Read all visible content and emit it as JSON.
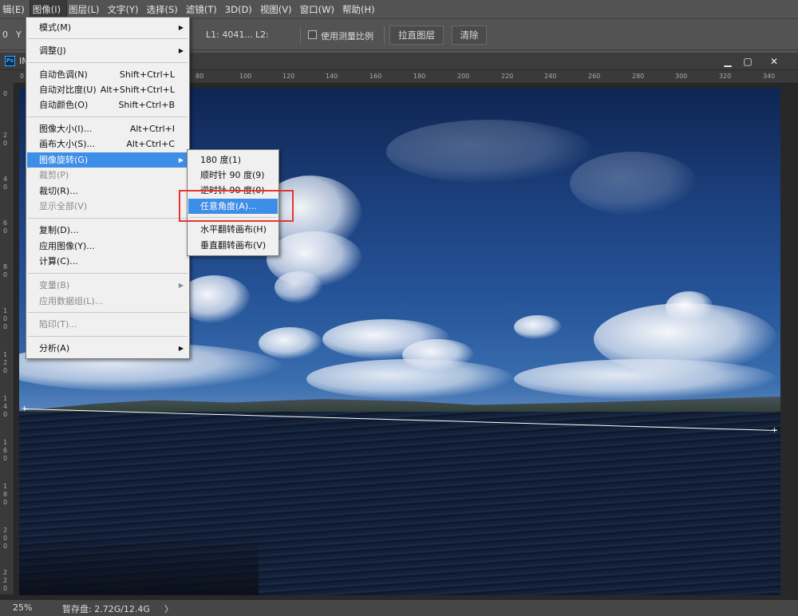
{
  "menubar": {
    "items": [
      "辑(E)",
      "图像(I)",
      "图层(L)",
      "文字(Y)",
      "选择(S)",
      "滤镜(T)",
      "3D(D)",
      "视图(V)",
      "窗口(W)",
      "帮助(H)"
    ]
  },
  "options": {
    "x_label": "0",
    "y_label": "Y",
    "l1": "L1: 4041...",
    "l2": "L2:",
    "measure_scale": "使用测量比例",
    "straighten_button": "拉直图层",
    "clear_button": "清除"
  },
  "document": {
    "title": "IM",
    "ruler_h": [
      "0",
      "80",
      "100",
      "120",
      "140",
      "160",
      "180",
      "200",
      "220",
      "240",
      "260",
      "280",
      "300",
      "320",
      "340"
    ],
    "ruler_v": [
      "0",
      "20",
      "40",
      "60",
      "80",
      "100",
      "120",
      "140",
      "160",
      "180",
      "200",
      "220"
    ]
  },
  "image_menu": {
    "items": [
      {
        "label": "模式(M)",
        "submenu": true
      },
      {
        "divider": true
      },
      {
        "label": "调整(J)",
        "submenu": true
      },
      {
        "divider": true
      },
      {
        "label": "自动色调(N)",
        "shortcut": "Shift+Ctrl+L"
      },
      {
        "label": "自动对比度(U)",
        "shortcut": "Alt+Shift+Ctrl+L"
      },
      {
        "label": "自动颜色(O)",
        "shortcut": "Shift+Ctrl+B"
      },
      {
        "divider": true
      },
      {
        "label": "图像大小(I)...",
        "shortcut": "Alt+Ctrl+I"
      },
      {
        "label": "画布大小(S)...",
        "shortcut": "Alt+Ctrl+C"
      },
      {
        "label": "图像旋转(G)",
        "submenu": true,
        "highlight": true
      },
      {
        "label": "裁剪(P)",
        "disabled": true
      },
      {
        "label": "裁切(R)..."
      },
      {
        "label": "显示全部(V)",
        "disabled": true
      },
      {
        "divider": true
      },
      {
        "label": "复制(D)..."
      },
      {
        "label": "应用图像(Y)..."
      },
      {
        "label": "计算(C)..."
      },
      {
        "divider": true
      },
      {
        "label": "变量(B)",
        "submenu": true,
        "disabled": true
      },
      {
        "label": "应用数据组(L)...",
        "disabled": true
      },
      {
        "divider": true
      },
      {
        "label": "陷印(T)...",
        "disabled": true
      },
      {
        "divider": true
      },
      {
        "label": "分析(A)",
        "submenu": true
      }
    ]
  },
  "rotate_menu": {
    "items": [
      {
        "label": "180 度(1)"
      },
      {
        "label": "顺时针 90 度(9)"
      },
      {
        "label": "逆时针 90 度(0)"
      },
      {
        "label": "任意角度(A)...",
        "highlight": true
      },
      {
        "divider": true
      },
      {
        "label": "水平翻转画布(H)"
      },
      {
        "label": "垂直翻转画布(V)"
      }
    ]
  },
  "status": {
    "zoom": "25%",
    "scratch": "暂存盘: 2.72G/12.4G",
    "arrow": "〉"
  },
  "colors": {
    "highlight": "#3d8ee6",
    "annotation": "#e8352e"
  }
}
